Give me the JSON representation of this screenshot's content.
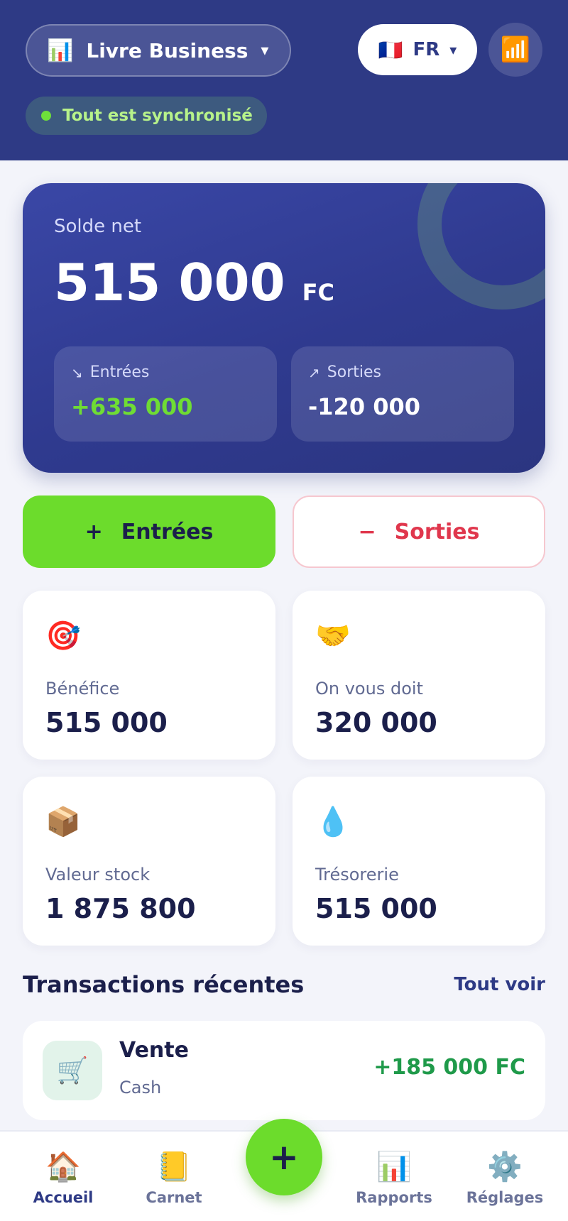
{
  "header": {
    "book_icon": "📊",
    "book_name": "Livre Business",
    "book_chevron": "▾",
    "lang_flag": "🇫🇷",
    "lang_code": "FR",
    "lang_chevron": "▾",
    "signal_icon": "📶",
    "sync_status": "Tout est synchronisé"
  },
  "balance": {
    "label": "Solde net",
    "amount": "515 000",
    "currency": "FC",
    "income": {
      "arrow": "↘",
      "label": "Entrées",
      "value": "+635 000"
    },
    "expense": {
      "arrow": "↗",
      "label": "Sorties",
      "value": "-120 000"
    }
  },
  "actions": {
    "income": {
      "sign": "+",
      "label": "Entrées"
    },
    "expense": {
      "sign": "−",
      "label": "Sorties"
    }
  },
  "stats": [
    {
      "icon": "🎯",
      "label": "Bénéfice",
      "value": "515 000"
    },
    {
      "icon": "🤝",
      "label": "On vous doit",
      "value": "320 000"
    },
    {
      "icon": "📦",
      "label": "Valeur stock",
      "value": "1 875 800"
    },
    {
      "icon": "💧",
      "label": "Trésorerie",
      "value": "515 000"
    }
  ],
  "recent": {
    "title": "Transactions récentes",
    "see_all": "Tout voir",
    "items": [
      {
        "icon": "🛒",
        "name": "Vente",
        "method": "Cash",
        "amount": "+185 000 FC"
      }
    ]
  },
  "nav": {
    "items": [
      {
        "icon": "🏠",
        "label": "Accueil"
      },
      {
        "icon": "📒",
        "label": "Carnet"
      },
      {
        "icon": "📊",
        "label": "Rapports"
      },
      {
        "icon": "⚙️",
        "label": "Réglages"
      }
    ],
    "fab_icon": "+"
  },
  "colors": {
    "primary": "#2e3a85",
    "accent_green": "#6cdc2c",
    "expense_red": "#e0374d",
    "income_text": "#1f9a4a"
  }
}
